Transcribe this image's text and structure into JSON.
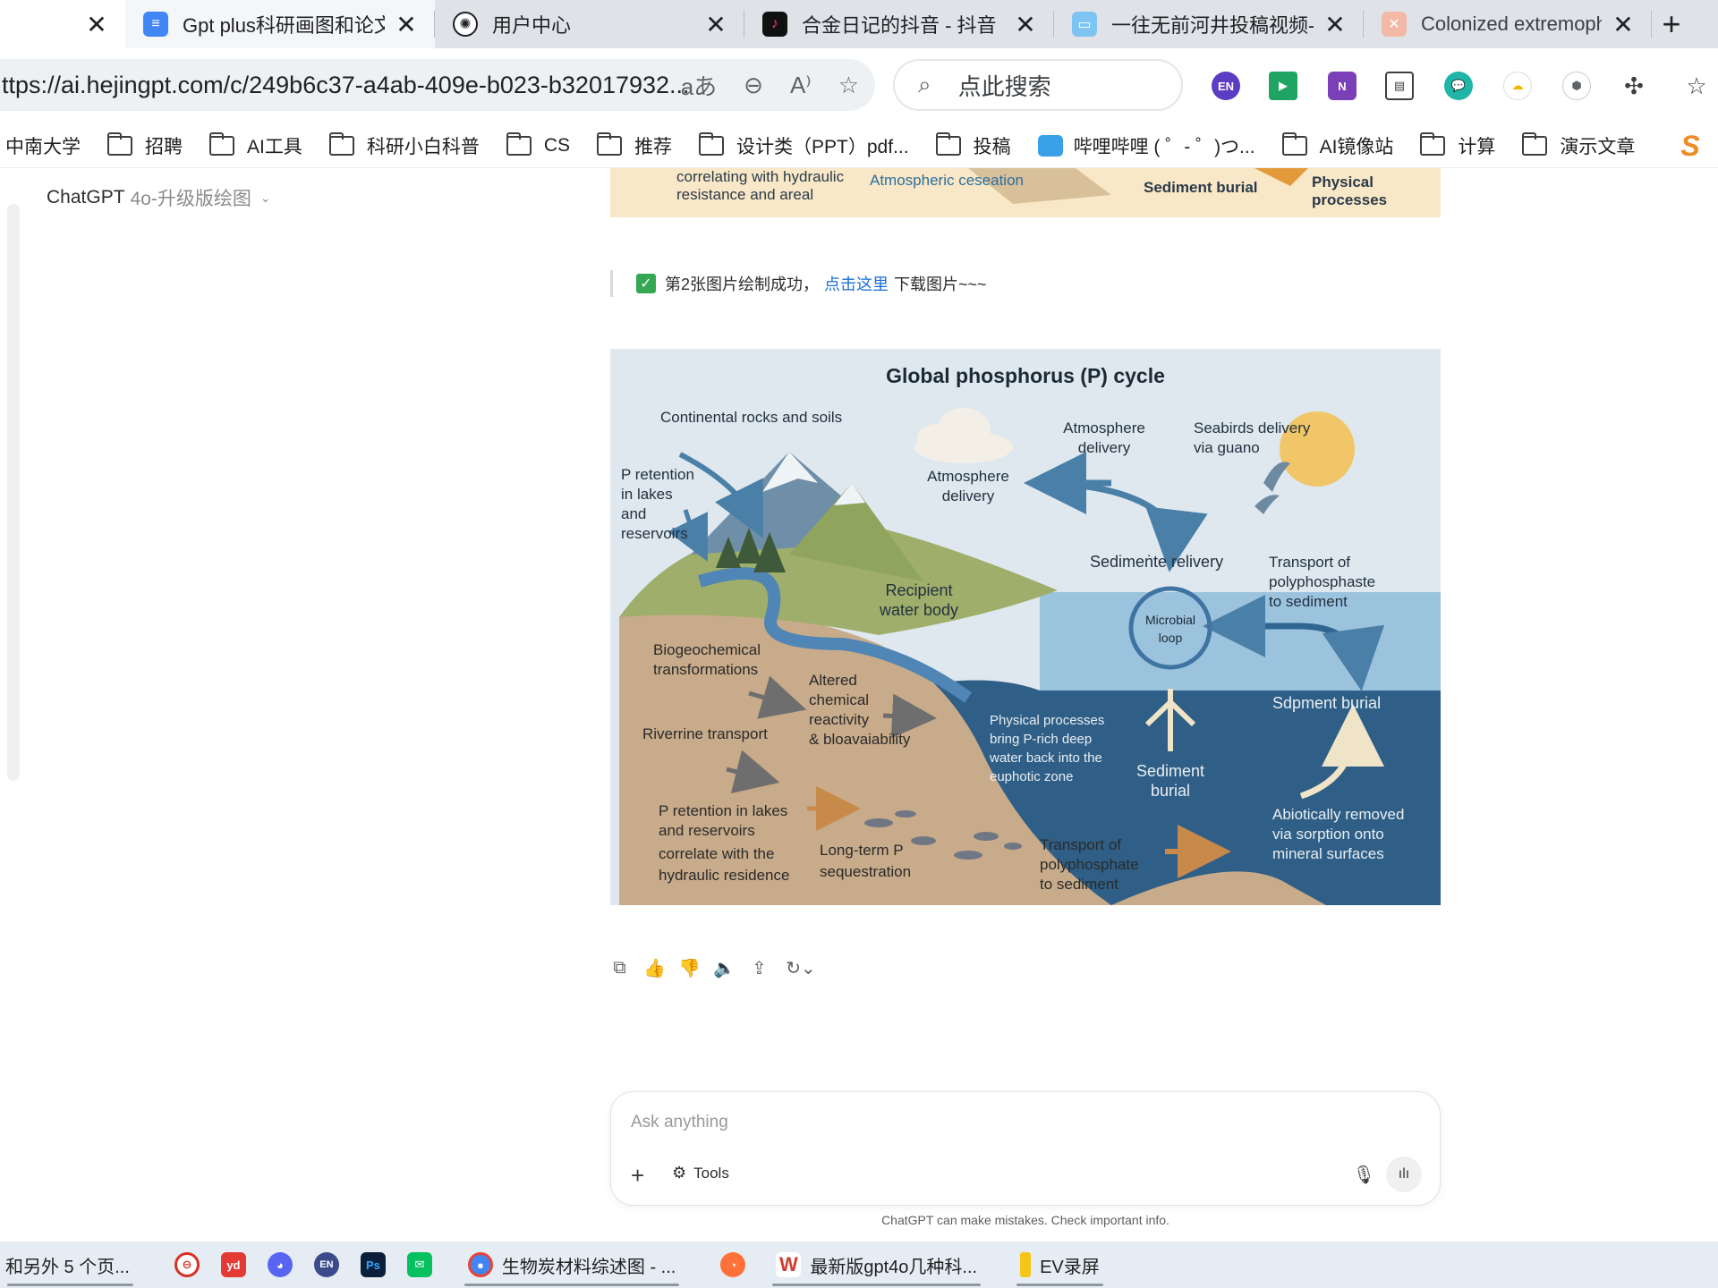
{
  "browser": {
    "tabs": [
      {
        "title": "",
        "icon": "blank-tab",
        "color": "#ffffff"
      },
      {
        "title": "Gpt plus科研画图和论文",
        "icon": "docs-icon",
        "color": "#4285f4"
      },
      {
        "title": "用户中心",
        "icon": "openai-icon",
        "color": "#202124"
      },
      {
        "title": "合金日记的抖音 - 抖音",
        "icon": "douyin-icon",
        "color": "#111111"
      },
      {
        "title": "一往无前河井投稿视频-",
        "icon": "bilibili-icon",
        "color": "#7ec3f2"
      },
      {
        "title": "Colonized extremophile",
        "icon": "paper-icon",
        "color": "#f3b9a6"
      }
    ],
    "url": "ttps://ai.hejingpt.com/c/249b6c37-a4ab-409e-b023-b32017932...",
    "search_placeholder": "点此搜索",
    "ext_en": "EN",
    "ext_n": "N",
    "bookmarks": [
      {
        "label": "中南大学",
        "type": "text"
      },
      {
        "label": "招聘",
        "type": "folder"
      },
      {
        "label": "AI工具",
        "type": "folder"
      },
      {
        "label": "科研小白科普",
        "type": "folder"
      },
      {
        "label": "CS",
        "type": "folder"
      },
      {
        "label": "推荐",
        "type": "folder"
      },
      {
        "label": "设计类（PPT）pdf...",
        "type": "folder"
      },
      {
        "label": "投稿",
        "type": "folder"
      },
      {
        "label": "哔哩哔哩 ( ゜- ゜)つ...",
        "type": "tv"
      },
      {
        "label": "AI镜像站",
        "type": "folder"
      },
      {
        "label": "计算",
        "type": "folder"
      },
      {
        "label": "演示文章",
        "type": "folder"
      }
    ],
    "bookmark_s": "S"
  },
  "chat": {
    "model_name": "ChatGPT",
    "model_variant": "4o-升级版绘图",
    "prev_image_labels": {
      "a": "correlating with hydraulic",
      "b": "resistance and areal",
      "c": "Atmospheric ceseation",
      "d": "Sediment burial",
      "e": "Physical",
      "f": "processes"
    },
    "status_prefix": "第2张图片绘制成功，",
    "status_link": "点击这里",
    "status_suffix": "下载图片~~~",
    "composer_placeholder": "Ask anything",
    "tools_label": "Tools",
    "disclaimer": "ChatGPT can make mistakes. Check important info."
  },
  "diagram": {
    "title": "Global phosphorus (P) cycle",
    "labels": {
      "continental": "Continental rocks and soils",
      "p_ret_1": "P retention",
      "p_ret_2": "in lakes",
      "p_ret_3": "and",
      "p_ret_4": "reservoirs",
      "atm1_1": "Atmosphere",
      "atm1_2": "delivery",
      "atm2_1": "Atmosphere",
      "atm2_2": "delivery",
      "seabirds_1": "Seabirds delivery",
      "seabirds_2": "via guano",
      "sed_relivery": "Sedimeṅte relivery",
      "transport_1": "Transport of",
      "transport_2": "polyphosphaste",
      "transport_3": "to sediment",
      "recipient_1": "Recipient",
      "recipient_2": "water body",
      "microbial_1": "Microbial",
      "microbial_2": "loop",
      "biogeo_1": "Biogeochemical",
      "biogeo_2": "transformations",
      "altered_1": "Altered",
      "altered_2": "chemical",
      "altered_3": "reactivity",
      "altered_4": "& bloavaiability",
      "riverine": "Riverrine transport",
      "physical_1": "Physical processes",
      "physical_2": "bring P-rich deep",
      "physical_3": "water back into the",
      "physical_4": "euphotic zone",
      "sed_burial_1": "Sediment",
      "sed_burial_2": "burial",
      "sdpment": "Sdpment burial",
      "abiotic_1": "Abiotically removed",
      "abiotic_2": "via sorption onto",
      "abiotic_3": "mineral surfaces",
      "pret_lakes_1": "P retention in lakes",
      "pret_lakes_2": "and reservoirs",
      "pret_lakes_3": "correlate with the",
      "pret_lakes_4": "hydraulic residence",
      "longterm_1": "Long-term P",
      "longterm_2": "sequestration",
      "transport_b_1": "Transport of",
      "transport_b_2": "polyphosphate",
      "transport_b_3": "to sediment"
    }
  },
  "taskbar": {
    "items": [
      {
        "label": "和另外 5 个页...",
        "icon": "",
        "color": ""
      },
      {
        "label": "",
        "icon": "app-red-icon",
        "color": "#d93025"
      },
      {
        "label": "",
        "icon": "youdao-icon",
        "color": "#e53935"
      },
      {
        "label": "",
        "icon": "discord-icon",
        "color": "#5865f2"
      },
      {
        "label": "",
        "icon": "en-icon",
        "color": "#3c4a8c"
      },
      {
        "label": "",
        "icon": "photoshop-icon",
        "color": "#0b1f3a"
      },
      {
        "label": "",
        "icon": "wechat-icon",
        "color": "#07c160"
      },
      {
        "label": "生物炭材料综述图 - ...",
        "icon": "chrome-icon",
        "color": "#4285f4"
      },
      {
        "label": "",
        "icon": "firefox-icon",
        "color": "#ff7139"
      },
      {
        "label": "最新版gpt4o几种科...",
        "icon": "wps-icon",
        "color": "#d23c2f"
      },
      {
        "label": "EV录屏",
        "icon": "ev-icon",
        "color": "#f5c518"
      }
    ]
  }
}
